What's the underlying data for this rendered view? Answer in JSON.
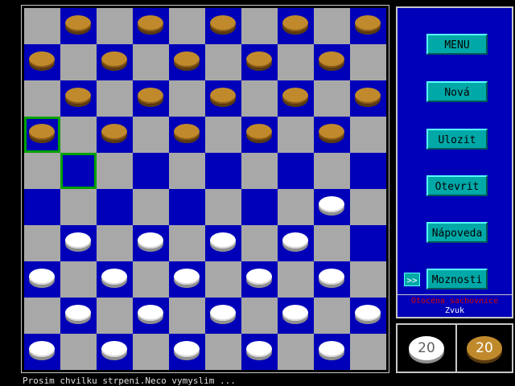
{
  "board": {
    "size": 10,
    "selected_piece": {
      "row": 3,
      "col": 0
    },
    "target_square": {
      "row": 4,
      "col": 1
    },
    "gold_pieces": [
      [
        0,
        1
      ],
      [
        0,
        3
      ],
      [
        0,
        5
      ],
      [
        0,
        7
      ],
      [
        0,
        9
      ],
      [
        1,
        0
      ],
      [
        1,
        2
      ],
      [
        1,
        4
      ],
      [
        1,
        6
      ],
      [
        1,
        8
      ],
      [
        2,
        1
      ],
      [
        2,
        3
      ],
      [
        2,
        5
      ],
      [
        2,
        7
      ],
      [
        2,
        9
      ],
      [
        3,
        0
      ],
      [
        3,
        2
      ],
      [
        3,
        4
      ],
      [
        3,
        6
      ],
      [
        3,
        8
      ]
    ],
    "white_pieces": [
      [
        5,
        8
      ],
      [
        6,
        1
      ],
      [
        6,
        3
      ],
      [
        6,
        5
      ],
      [
        6,
        7
      ],
      [
        7,
        0
      ],
      [
        7,
        2
      ],
      [
        7,
        4
      ],
      [
        7,
        6
      ],
      [
        7,
        8
      ],
      [
        8,
        1
      ],
      [
        8,
        3
      ],
      [
        8,
        5
      ],
      [
        8,
        7
      ],
      [
        8,
        9
      ],
      [
        9,
        0
      ],
      [
        9,
        2
      ],
      [
        9,
        4
      ],
      [
        9,
        6
      ],
      [
        9,
        8
      ]
    ]
  },
  "menu": {
    "items": [
      {
        "label": "MENU"
      },
      {
        "label": "Nová"
      },
      {
        "label": "Ulozit"
      },
      {
        "label": "Otevrit"
      },
      {
        "label": "Nápoveda"
      },
      {
        "label": "Moznosti"
      }
    ],
    "arrow_label": ">>",
    "status_red": "Otocena sachovnice",
    "status_white": "Zvuk"
  },
  "score": {
    "white": "20",
    "gold": "20"
  },
  "footer": "Prosim chvilku strpeni.Neco vymyslim ...",
  "colors": {
    "dark_square": "#0000b8",
    "light_square": "#a8a8a8",
    "gold_piece": "#c08a2c",
    "white_piece": "#ffffff",
    "selection": "#00a000",
    "button": "#00a8a8"
  }
}
